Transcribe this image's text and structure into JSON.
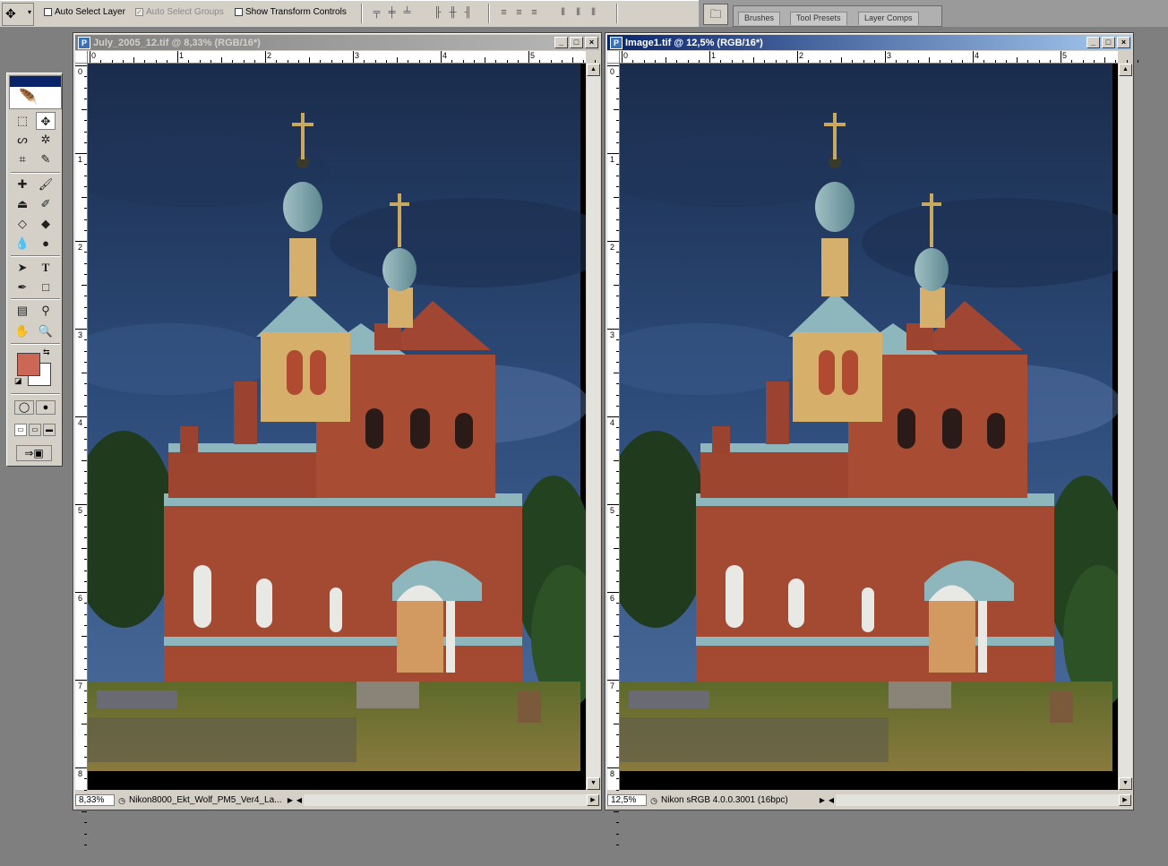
{
  "options_bar": {
    "tool_icon": "move-icon",
    "auto_select_layer": {
      "label": "Auto Select Layer",
      "checked": false
    },
    "auto_select_groups": {
      "label": "Auto Select Groups",
      "checked": true,
      "disabled": true
    },
    "show_transform_controls": {
      "label": "Show Transform Controls",
      "checked": false
    }
  },
  "palette_well": {
    "tabs": [
      "Brushes",
      "Tool Presets",
      "Layer Comps"
    ]
  },
  "toolbox": {
    "foreground_color": "#cc6655",
    "background_color": "#ffffff"
  },
  "documents": [
    {
      "title": "July_2005_12.tif @ 8,33% (RGB/16*)",
      "active": false,
      "zoom": "8,33%",
      "status_info": "Nikon8000_Ekt_Wolf_PM5_Ver4_La...",
      "ruler_top_labels": [
        "0",
        "1",
        "2",
        "3",
        "4",
        "5"
      ],
      "ruler_left_labels": [
        "0",
        "1",
        "2",
        "3",
        "4",
        "5",
        "6",
        "7",
        "8"
      ]
    },
    {
      "title": "Image1.tif @ 12,5% (RGB/16*)",
      "active": true,
      "zoom": "12,5%",
      "status_info": "Nikon sRGB 4.0.0.3001 (16bpc)",
      "ruler_top_labels": [
        "0",
        "1",
        "2",
        "3",
        "4",
        "5"
      ],
      "ruler_left_labels": [
        "0",
        "1",
        "2",
        "3",
        "4",
        "5",
        "6",
        "7",
        "8"
      ]
    }
  ],
  "window_buttons": {
    "minimize": "_",
    "maximize": "□",
    "close": "×"
  }
}
